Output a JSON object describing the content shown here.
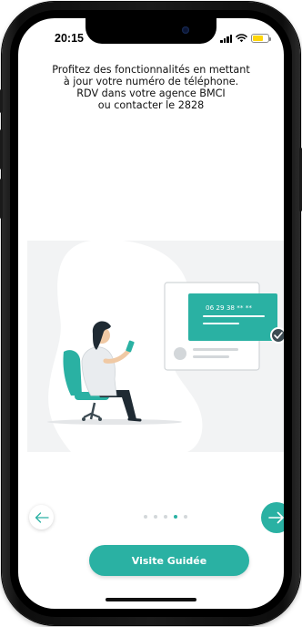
{
  "status_bar": {
    "time": "20:15",
    "icons": [
      "signal-icon",
      "wifi-icon",
      "battery-icon"
    ],
    "battery_color": "#ffd60a"
  },
  "message": {
    "lines": [
      "Profitez des fonctionnalités en mettant",
      "à jour votre numéro de téléphone.",
      "RDV dans votre agence BMCI",
      "ou contacter le 2828"
    ]
  },
  "illustration": {
    "phone_number": "06 29 38 ** **",
    "check_icon": "check-icon"
  },
  "pager": {
    "total": 5,
    "active_index": 3,
    "prev_icon": "arrow-left-icon",
    "next_icon": "arrow-right-icon"
  },
  "guide_button": {
    "label": "Visite Guidée"
  },
  "colors": {
    "accent": "#2ab1a3",
    "panel_bg": "#f2f3f4",
    "inactive_dot": "#d3d7da"
  }
}
